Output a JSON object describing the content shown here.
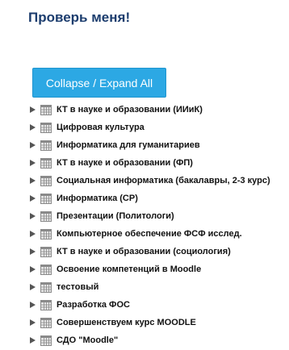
{
  "page": {
    "title": "Проверь меня!"
  },
  "toolbar": {
    "collapse_expand_label": "Collapse / Expand All"
  },
  "courses": [
    {
      "label": "КТ в науке и образовании (ИИиК)",
      "icon": "calendar-grid-icon"
    },
    {
      "label": "Цифровая культура",
      "icon": "calendar-grid-icon"
    },
    {
      "label": "Информатика для гуманитариев",
      "icon": "calendar-grid-icon"
    },
    {
      "label": "КТ в науке и образовании (ФП)",
      "icon": "calendar-grid-icon"
    },
    {
      "label": "Социальная информатика (бакалавры, 2-3 курс)",
      "icon": "calendar-grid-icon"
    },
    {
      "label": "Информатика (СР)",
      "icon": "calendar-grid-icon"
    },
    {
      "label": "Презентации (Политологи)",
      "icon": "calendar-grid-icon"
    },
    {
      "label": "Компьютерное обеспечение ФСФ исслед.",
      "icon": "calendar-grid-icon"
    },
    {
      "label": "КТ в науке и образовании (социология)",
      "icon": "calendar-grid-icon"
    },
    {
      "label": "Освоение компетенций в Moodle",
      "icon": "calendar-grid-icon"
    },
    {
      "label": "тестовый",
      "icon": "calendar-grid-icon"
    },
    {
      "label": "Разработка ФОС",
      "icon": "calendar-grid-icon"
    },
    {
      "label": "Совершенствуем курс MOODLE",
      "icon": "calendar-grid-icon"
    },
    {
      "label": "СДО \"Moodle\"",
      "icon": "calendar-grid-icon"
    }
  ],
  "colors": {
    "title": "#1c3d6e",
    "button_bg": "#2ca8e4",
    "button_text": "#ffffff",
    "arrow": "#555555",
    "icon_border": "#8a8a8a",
    "icon_fill": "#e6e6e6"
  }
}
